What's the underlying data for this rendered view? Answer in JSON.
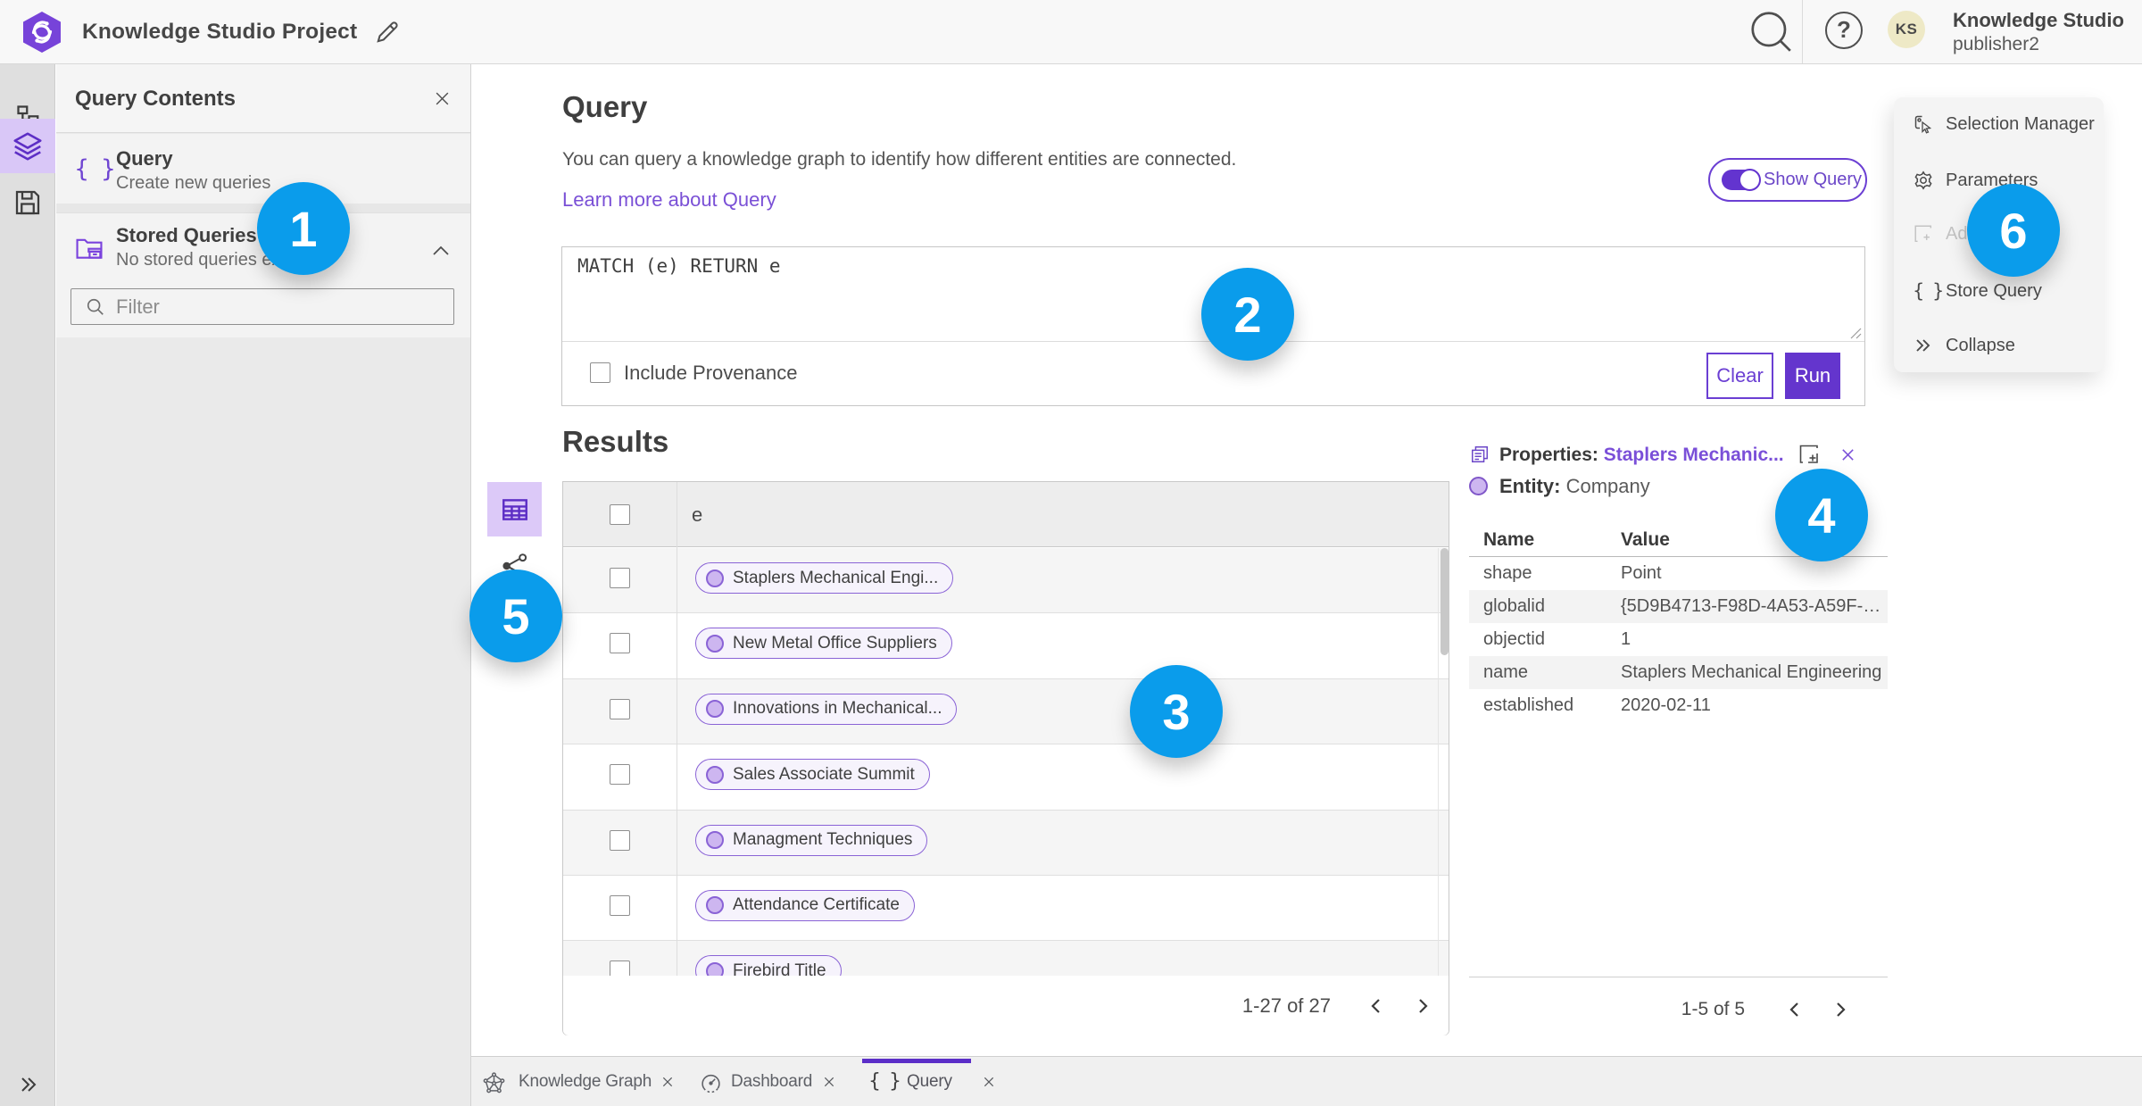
{
  "header": {
    "title": "Knowledge Studio Project",
    "user_name": "Knowledge Studio",
    "user_role": "publisher2",
    "avatar_initials": "KS"
  },
  "left_panel": {
    "title": "Query Contents",
    "query_item": {
      "title": "Query",
      "subtitle": "Create new queries"
    },
    "stored_item": {
      "title": "Stored Queries",
      "subtitle": "No stored queries exist"
    },
    "filter_placeholder": "Filter"
  },
  "query_section": {
    "heading": "Query",
    "description": "You can query a knowledge graph to identify how different entities are connected.",
    "learn_more": "Learn more about Query",
    "show_query_label": "Show Query",
    "show_query_on": true,
    "query_text": "MATCH (e) RETURN e",
    "include_provenance_label": "Include Provenance",
    "include_provenance_checked": false,
    "clear_label": "Clear",
    "run_label": "Run"
  },
  "results": {
    "heading": "Results",
    "column": "e",
    "rows": [
      "Staplers Mechanical Engi...",
      "New Metal Office Suppliers",
      "Innovations in Mechanical...",
      "Sales Associate Summit",
      "Managment Techniques",
      "Attendance Certificate",
      "Firebird Title"
    ],
    "pagination": {
      "range": "1-27 of 27"
    }
  },
  "properties": {
    "title": "Properties:",
    "selected_name": "Staplers Mechanic...",
    "entity_label": "Entity:",
    "entity_type": "Company",
    "columns": {
      "name": "Name",
      "value": "Value"
    },
    "rows": [
      {
        "name": "shape",
        "value": "Point"
      },
      {
        "name": "globalid",
        "value": "{5D9B4713-F98D-4A53-A59F-C11..."
      },
      {
        "name": "objectid",
        "value": "1"
      },
      {
        "name": "name",
        "value": "Staplers Mechanical Engineering"
      },
      {
        "name": "established",
        "value": "2020-02-11"
      }
    ],
    "pagination": {
      "range": "1-5 of 5"
    }
  },
  "side_menu": {
    "items": [
      {
        "label": "Selection Manager",
        "disabled": false
      },
      {
        "label": "Parameters",
        "disabled": false
      },
      {
        "label": "Ad",
        "disabled": true
      },
      {
        "label": "Store Query",
        "disabled": false
      },
      {
        "label": "Collapse",
        "disabled": false
      }
    ]
  },
  "tabs": [
    {
      "label": "Knowledge Graph",
      "active": false
    },
    {
      "label": "Dashboard",
      "active": false
    },
    {
      "label": "Query",
      "active": true
    }
  ],
  "callouts": [
    "1",
    "2",
    "3",
    "4",
    "5",
    "6"
  ],
  "icons": {
    "logo": "hexagon-swirl",
    "edit": "pencil",
    "search": "magnifier",
    "help": "question-circle",
    "strip": [
      "data-model",
      "layers",
      "save",
      "expand"
    ],
    "braces": "{ }",
    "view_toggle": [
      "table",
      "link-chart"
    ],
    "tab_icons": [
      "knowledge-graph",
      "dashboard",
      "braces"
    ]
  },
  "colors": {
    "accent_purple": "#6435cd",
    "light_purple": "#dcc9f8",
    "link_purple": "#7a50d6",
    "pill_border": "#8a63d6",
    "callout_blue": "#0a9ceb"
  }
}
